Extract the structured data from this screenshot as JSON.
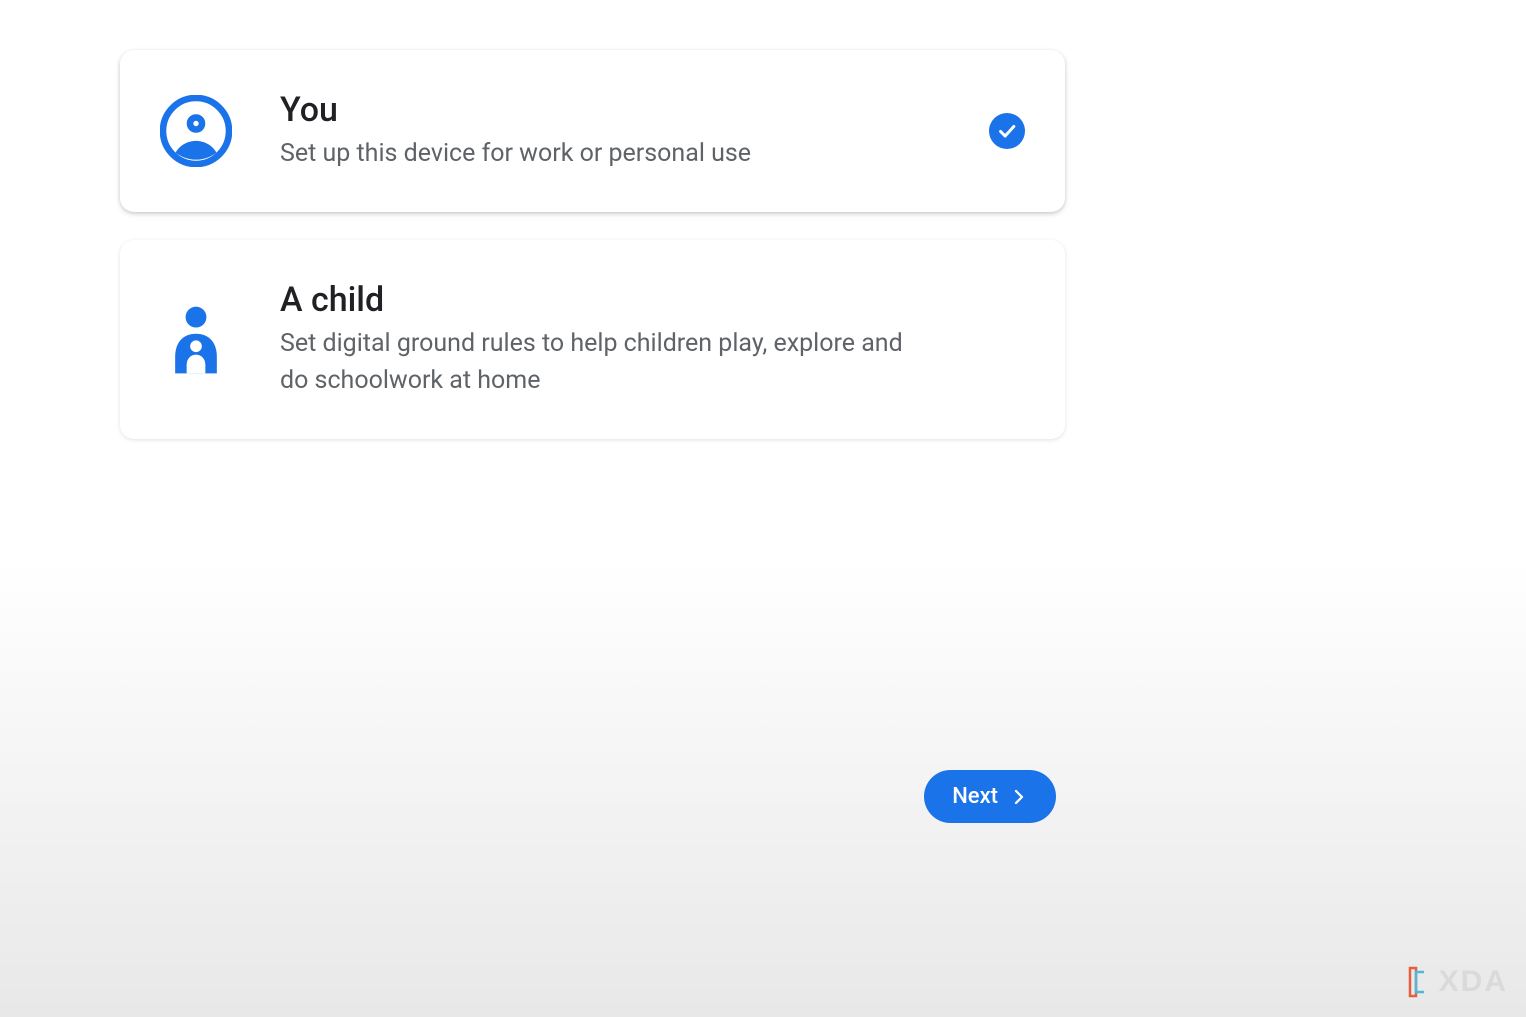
{
  "options": [
    {
      "title": "You",
      "subtitle": "Set up this device for work or personal use",
      "selected": true
    },
    {
      "title": "A child",
      "subtitle": "Set digital ground rules to help children play, explore and do schoolwork at home",
      "selected": false
    }
  ],
  "buttons": {
    "next_label": "Next"
  },
  "watermark": {
    "text": "XDA"
  },
  "colors": {
    "accent": "#1a73e8"
  }
}
